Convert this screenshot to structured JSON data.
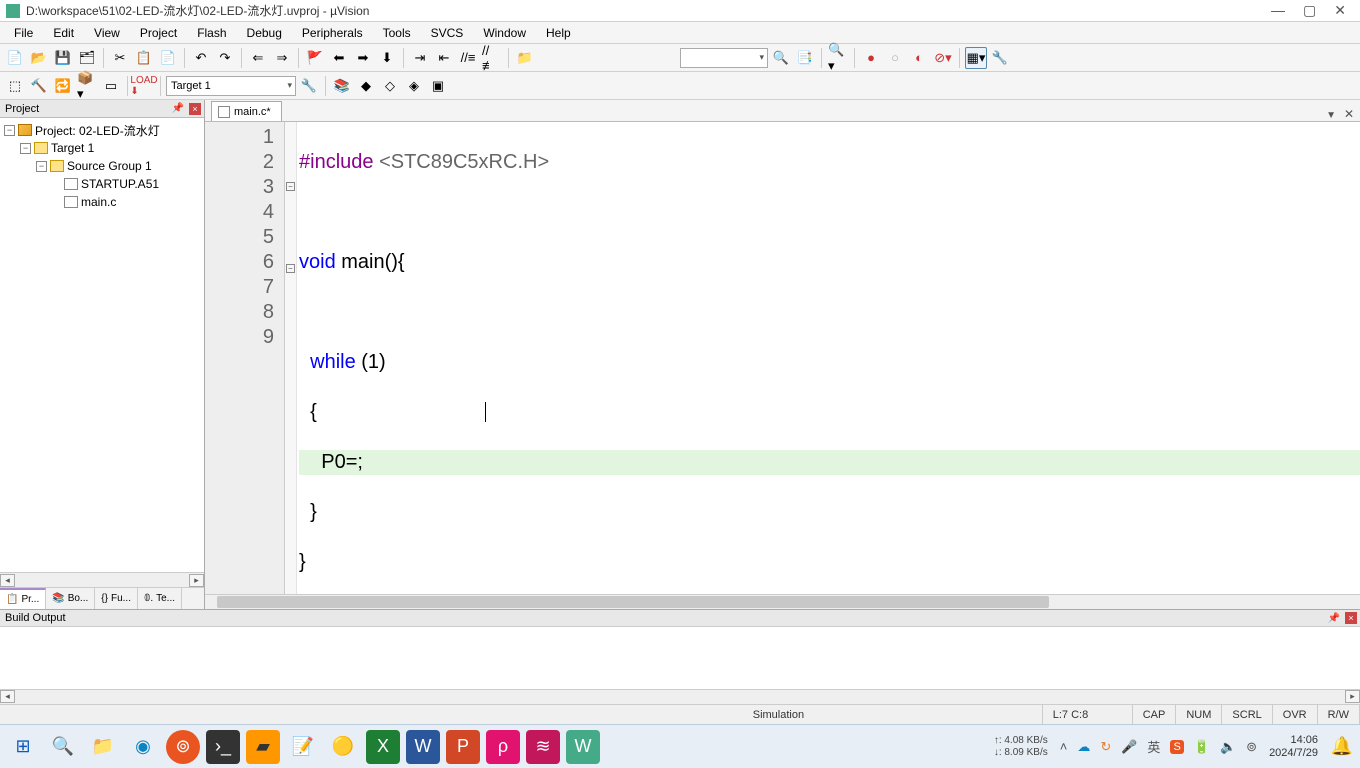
{
  "title": "D:\\workspace\\51\\02-LED-流水灯\\02-LED-流水灯.uvproj - µVision",
  "menu": [
    "File",
    "Edit",
    "View",
    "Project",
    "Flash",
    "Debug",
    "Peripherals",
    "Tools",
    "SVCS",
    "Window",
    "Help"
  ],
  "toolbar2_target": "Target 1",
  "project_panel": {
    "title": "Project",
    "root": "Project: 02-LED-流水灯",
    "target": "Target 1",
    "group": "Source Group 1",
    "files": [
      "STARTUP.A51",
      "main.c"
    ],
    "tabs": [
      "Pr...",
      "Bo...",
      "Fu...",
      "Te..."
    ]
  },
  "editor": {
    "tab": "main.c*",
    "lines": {
      "l1_pre": "#include ",
      "l1_inc": "<STC89C5xRC.H>",
      "l3_a": "void",
      "l3_b": " main(){",
      "l5_a": "  ",
      "l5_b": "while",
      "l5_c": " (",
      "l5_d": "1",
      "l5_e": ")",
      "l6": "  {",
      "l7": "    P0=;",
      "l8": "  }",
      "l9": "}"
    },
    "gutter": [
      "1",
      "2",
      "3",
      "4",
      "5",
      "6",
      "7",
      "8",
      "9"
    ]
  },
  "build_output_title": "Build Output",
  "status": {
    "mode": "Simulation",
    "pos": "L:7 C:8",
    "caps": "CAP",
    "num": "NUM",
    "scrl": "SCRL",
    "ovr": "OVR",
    "rw": "R/W"
  },
  "taskbar": {
    "net_up": "↑: 4.08 KB/s",
    "net_dn": "↓: 8.09 KB/s",
    "time": "14:06",
    "date": "2024/7/29",
    "ime": "英"
  }
}
